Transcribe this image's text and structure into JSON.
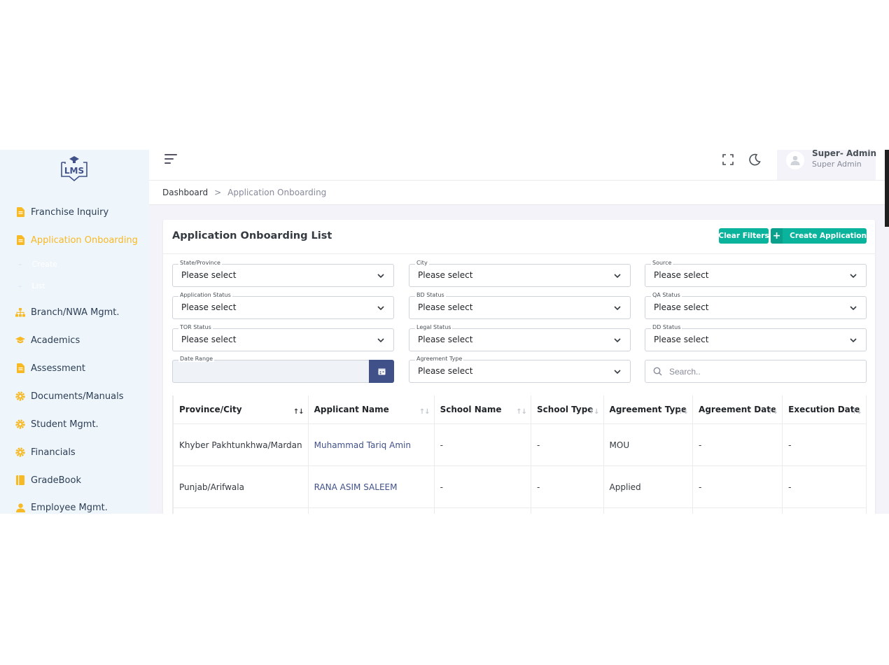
{
  "logo": {
    "text": "LMS"
  },
  "sidebar": {
    "items": [
      {
        "label": "Franchise Inquiry",
        "icon": "file-icon",
        "active": false
      },
      {
        "label": "Application Onboarding",
        "icon": "file-icon",
        "active": true
      },
      {
        "label": "Branch/NWA Mgmt.",
        "icon": "sitemap-icon",
        "active": false
      },
      {
        "label": "Academics",
        "icon": "graduation-cap-icon",
        "active": false
      },
      {
        "label": "Assessment",
        "icon": "file-icon",
        "active": false
      },
      {
        "label": "Documents/Manuals",
        "icon": "gear-icon",
        "active": false
      },
      {
        "label": "Student Mgmt.",
        "icon": "gear-icon",
        "active": false
      },
      {
        "label": "Financials",
        "icon": "gear-icon",
        "active": false
      },
      {
        "label": "GradeBook",
        "icon": "book-icon",
        "active": false
      },
      {
        "label": "Employee Mgmt.",
        "icon": "user-icon",
        "active": false
      }
    ],
    "sub_items": [
      {
        "label": "Create"
      },
      {
        "label": "List"
      }
    ]
  },
  "topbar": {
    "user_name": "Super- Admin",
    "user_role": "Super Admin"
  },
  "breadcrumb": {
    "home": "Dashboard",
    "separator": ">",
    "current": "Application Onboarding"
  },
  "card": {
    "title": "Application Onboarding List",
    "clear_filters": "Clear Filters",
    "create_plus": "+",
    "create_label": "Create Application"
  },
  "filters": {
    "state": {
      "label": "State/Province",
      "value": "Please select"
    },
    "city": {
      "label": "City",
      "value": "Please select"
    },
    "source": {
      "label": "Source",
      "value": "Please select"
    },
    "application_status": {
      "label": "Application Status",
      "value": "Please select"
    },
    "bd_status": {
      "label": "BD Status",
      "value": "Please select"
    },
    "qa_status": {
      "label": "QA Status",
      "value": "Please select"
    },
    "tor_status": {
      "label": "TOR Status",
      "value": "Please select"
    },
    "legal_status": {
      "label": "Legal Status",
      "value": "Please select"
    },
    "dd_status": {
      "label": "DD Status",
      "value": "Please select"
    },
    "date_range": {
      "label": "Date Range",
      "value": ""
    },
    "agreement_type": {
      "label": "Agreement Type",
      "value": "Please select"
    },
    "search": {
      "placeholder": "Search.."
    }
  },
  "table": {
    "sort_glyph": "↑↓",
    "active_sort_glyph": "↑↓",
    "columns": [
      "Province/City",
      "Applicant Name",
      "School Name",
      "School Type",
      "Agreement Type",
      "Agreement Date",
      "Execution Date"
    ],
    "rows": [
      [
        "Khyber Pakhtunkhwa/Mardan",
        "Muhammad Tariq Amin",
        "-",
        "-",
        "MOU",
        "-",
        "-"
      ],
      [
        "Punjab/Arifwala",
        "RANA ASIM SALEEM",
        "-",
        "-",
        "Applied",
        "-",
        "-"
      ]
    ]
  },
  "colors": {
    "accent": "#0ab39c",
    "primary": "#405189",
    "active_nav": "#f7b924",
    "sidebar_bg": "#eef5fb"
  }
}
